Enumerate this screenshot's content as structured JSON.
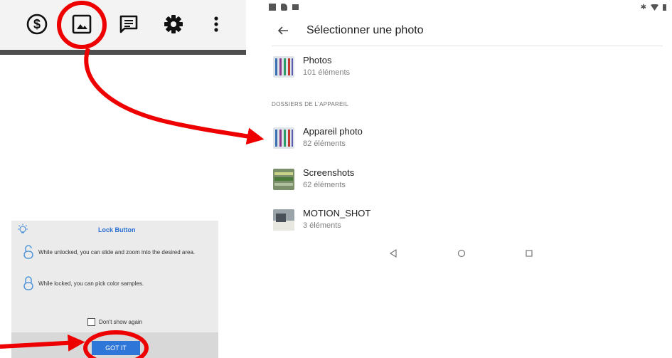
{
  "toolbar": {
    "icons": [
      "dollar-icon",
      "image-icon",
      "comment-icon",
      "settings-icon",
      "more-vert-icon"
    ]
  },
  "picker": {
    "title": "Sélectionner une photo",
    "section_label": "DOSSIERS DE L'APPAREIL",
    "folders": [
      {
        "name": "Photos",
        "count": "101 éléments"
      },
      {
        "name": "Appareil photo",
        "count": "82 éléments"
      },
      {
        "name": "Screenshots",
        "count": "62 éléments"
      },
      {
        "name": "MOTION_SHOT",
        "count": "3 éléments"
      }
    ]
  },
  "dialog": {
    "title": "Lock Button",
    "unlocked_text": "While unlocked, you can slide and zoom into the desired area.",
    "locked_text": "While locked, you can pick color samples.",
    "checkbox_label": "Don't show again",
    "button_label": "GOT IT"
  },
  "colors": {
    "annotation": "#ee0000",
    "accent": "#2e77d8",
    "title_blue": "#2b6fd4"
  }
}
